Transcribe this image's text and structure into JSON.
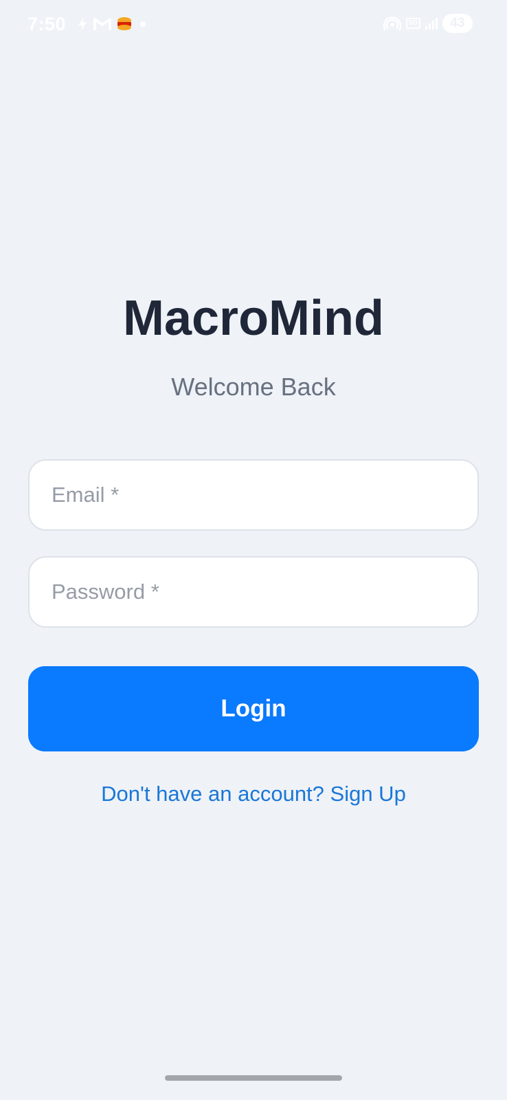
{
  "status_bar": {
    "time": "7:50",
    "network": "5G",
    "battery": "43",
    "icons": [
      "bolt-icon",
      "gmail-icon",
      "burger-king-icon",
      "notification-dot-icon",
      "hotspot-icon",
      "network-5g-icon",
      "signal-icon",
      "battery-icon"
    ]
  },
  "app": {
    "title": "MacroMind",
    "subtitle": "Welcome Back"
  },
  "form": {
    "email": {
      "value": "",
      "placeholder": "Email *"
    },
    "password": {
      "value": "",
      "placeholder": "Password *"
    },
    "login_label": "Login",
    "signup_text": "Don't have an account? Sign Up"
  },
  "colors": {
    "background": "#eff2f7",
    "primary": "#0a7afe",
    "link": "#1977d8",
    "title": "#1f2738",
    "subtitle": "#687180"
  }
}
